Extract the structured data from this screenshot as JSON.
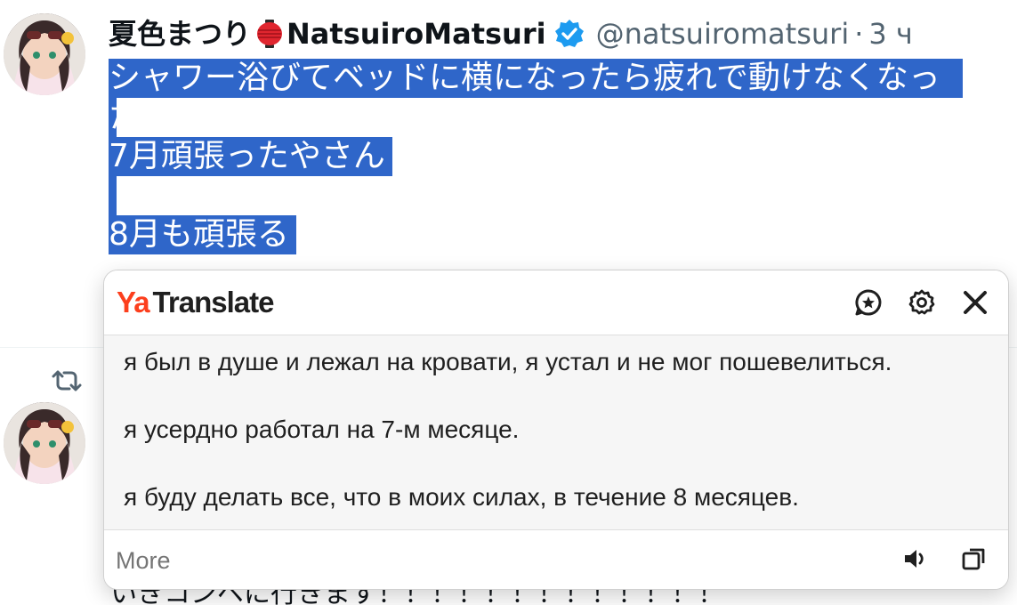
{
  "tweet": {
    "display_name": "夏色まつり",
    "display_name_latin": "NatsuiroMatsuri",
    "handle": "@natsuiromatsuri",
    "separator": "·",
    "time": "3 ч",
    "lines": [
      "シャワー浴びてベッドに横になったら疲れで動けなくなった",
      "",
      "7月頑張ったやさん",
      "",
      "8月も頑張る"
    ],
    "partial_below": "いきコンペに行きます！！！！！！！！！！！！！"
  },
  "translate_popup": {
    "brand_ya": "Ya",
    "brand_name": "Translate",
    "translations": [
      "я был в душе и лежал на кровати, я устал и не мог пошевелиться.",
      "я усердно работал на 7-м месяце.",
      "я буду делать все, что в моих силах, в течение 8 месяцев."
    ],
    "more_label": "More",
    "header_icons": [
      "favorite-icon",
      "settings-icon",
      "close-icon"
    ],
    "footer_icons": [
      "speaker-icon",
      "copy-icon"
    ]
  },
  "colors": {
    "selection": "#2f66c9",
    "verified": "#1d9bf0",
    "muted": "#536471",
    "brand_ya": "#fc3f1d"
  }
}
